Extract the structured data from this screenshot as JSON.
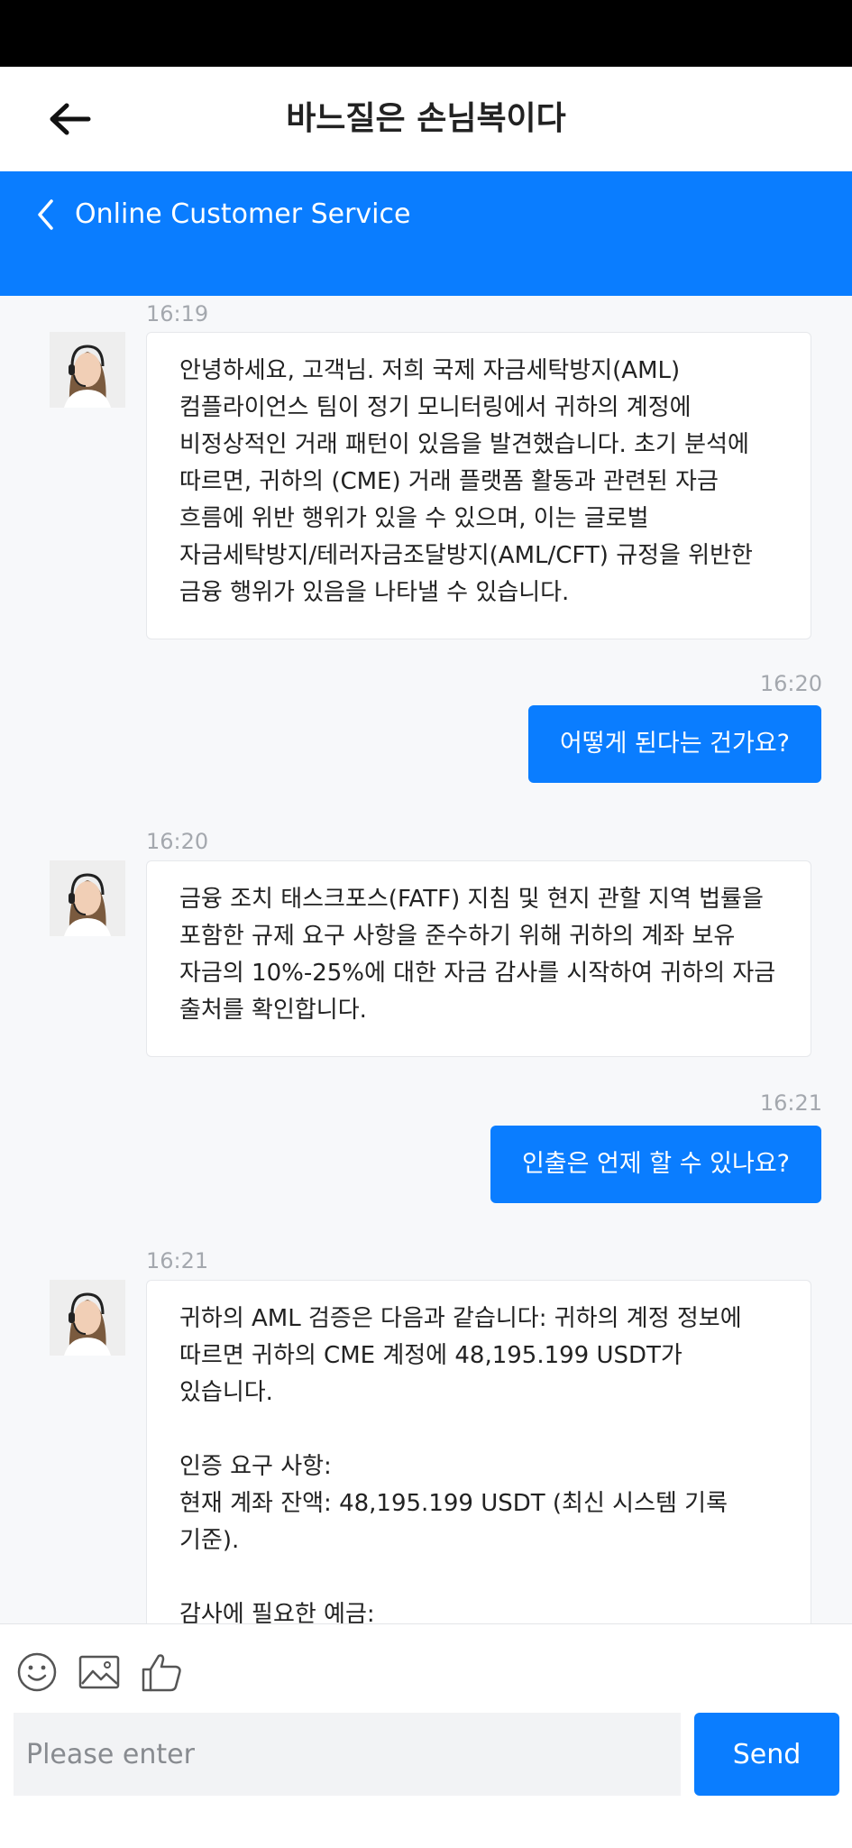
{
  "app_header": {
    "title": "바느질은 손님복이다",
    "back_icon": "arrow-left-icon"
  },
  "cs_header": {
    "title": "Online Customer Service",
    "back_icon": "chevron-left-icon"
  },
  "colors": {
    "accent": "#0a7dff",
    "page_bg": "#f7f8fa",
    "status_bar": "#000000",
    "time_text": "#a4a8ae"
  },
  "messages": [
    {
      "from": "agent",
      "time": "16:19",
      "text": "안녕하세요, 고객님. 저희 국제 자금세탁방지(AML) 컴플라이언스 팀이 정기 모니터링에서 귀하의 계정에 비정상적인 거래 패턴이 있음을 발견했습니다. 초기 분석에 따르면, 귀하의 (CME) 거래 플랫폼 활동과 관련된 자금 흐름에 위반 행위가 있을 수 있으며, 이는 글로벌 자금세탁방지/테러자금조달방지(AML/CFT) 규정을 위반한 금융 행위가 있음을 나타낼 수 있습니다."
    },
    {
      "from": "user",
      "time": "16:20",
      "text": "어떻게 된다는 건가요?"
    },
    {
      "from": "agent",
      "time": "16:20",
      "text": "금융 조치 태스크포스(FATF) 지침 및 현지 관할 지역 법률을 포함한 규제 요구 사항을 준수하기 위해 귀하의 계좌 보유 자금의 10%-25%에 대한 자금 감사를 시작하여 귀하의 자금 출처를 확인합니다."
    },
    {
      "from": "user",
      "time": "16:21",
      "text": "인출은 언제 할 수 있나요?"
    },
    {
      "from": "agent",
      "time": "16:21",
      "text": "귀하의 AML 검증은 다음과 같습니다: 귀하의 계정 정보에 따르면 귀하의 CME 계정에 48,195.199 USDT가 있습니다.\n\n인증 요구 사항:\n현재 계좌 잔액: 48,195.199 USDT (최신 시스템 기록 기준).\n\n감사에 필요한 예금:"
    }
  ],
  "footer": {
    "tools": [
      "smiley-icon",
      "image-icon",
      "thumbs-up-icon"
    ],
    "input_placeholder": "Please enter",
    "send_label": "Send"
  }
}
